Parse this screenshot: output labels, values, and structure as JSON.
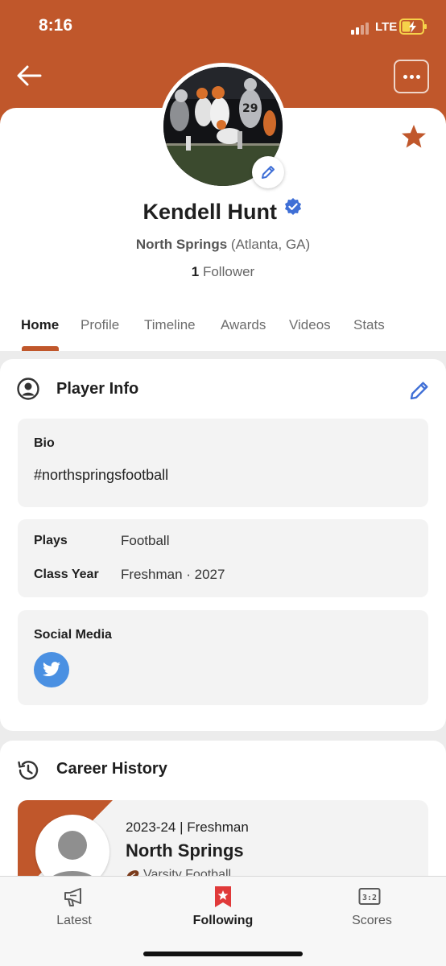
{
  "status_bar": {
    "time": "8:16",
    "network": "LTE"
  },
  "header": {
    "back_icon": "arrow-left-icon",
    "more_icon": "more-dots-icon",
    "favorite_icon": "star-icon"
  },
  "profile": {
    "name": "Kendell Hunt",
    "verified": true,
    "school": "North Springs",
    "location": "(Atlanta, GA)",
    "follower_count": "1",
    "follower_label": "Follower"
  },
  "tabs": [
    {
      "label": "Home",
      "active": true
    },
    {
      "label": "Profile"
    },
    {
      "label": "Timeline"
    },
    {
      "label": "Awards"
    },
    {
      "label": "Videos"
    },
    {
      "label": "Stats"
    }
  ],
  "player_info": {
    "title": "Player Info",
    "bio_label": "Bio",
    "bio_value": "#northspringsfootball",
    "plays_label": "Plays",
    "plays_value": "Football",
    "class_year_label": "Class Year",
    "class_year_value": "Freshman · 2027",
    "social_label": "Social Media",
    "social_icons": [
      "twitter-icon"
    ]
  },
  "career_history": {
    "title": "Career History",
    "items": [
      {
        "season": "2023-24 | Freshman",
        "team": "North Springs",
        "level": "Varsity Football"
      }
    ]
  },
  "bottom_nav": [
    {
      "label": "Latest",
      "icon": "megaphone-icon"
    },
    {
      "label": "Following",
      "icon": "bookmark-star-icon",
      "active": true
    },
    {
      "label": "Scores",
      "icon": "scoreboard-icon"
    }
  ],
  "colors": {
    "brand": "#c0572b",
    "accent_blue": "#3f6fd6",
    "twitter": "#4a90e2"
  }
}
